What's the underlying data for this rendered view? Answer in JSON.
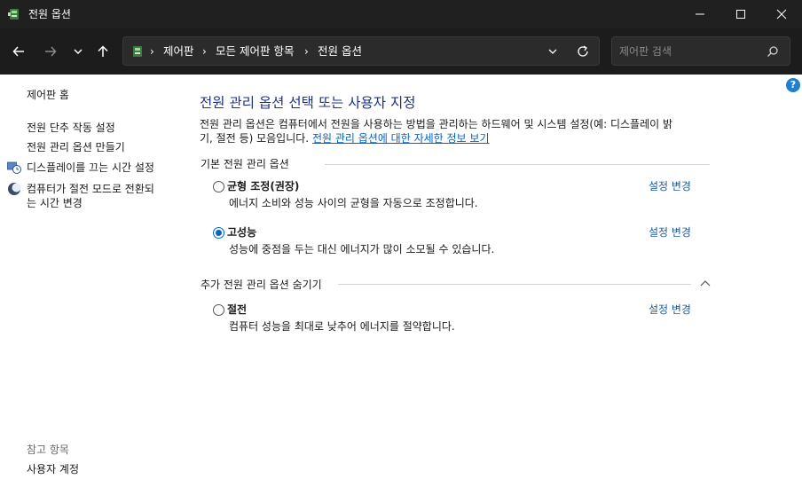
{
  "window": {
    "title": "전원 옵션"
  },
  "address": {
    "crumbs": [
      "제어판",
      "모든 제어판 항목",
      "전원 옵션"
    ],
    "search_placeholder": "제어판 검색"
  },
  "sidebar": {
    "home": "제어판 홈",
    "tasks": [
      "전원 단추 작동 설정",
      "전원 관리 옵션 만들기",
      "디스플레이를 끄는 시간 설정",
      "컴퓨터가 절전 모드로 전환되는 시간 변경"
    ],
    "task_line_wrap": [
      "컴퓨터가 절전 모드로 전환되",
      "는 시간 변경"
    ],
    "see_also_label": "참고 항목",
    "see_also_items": [
      "사용자 계정"
    ]
  },
  "main": {
    "heading": "전원 관리 옵션 선택 또는 사용자 지정",
    "description_line1": "전원 관리 옵션은 컴퓨터에서 전원을 사용하는 방법을 관리하는 하드웨어 및 시스템 설정(예: 디스플레이 밝",
    "description_line2": "기, 절전 등) 모음입니다.",
    "more_info_link": "전원 관리 옵션에 대한 자세한 정보 보기",
    "preferred_section": "기본 전원 관리 옵션",
    "hidden_section": "추가 전원 관리 옵션 숨기기",
    "change_settings": "설정 변경",
    "plans": [
      {
        "name": "균형 조정(권장)",
        "description": "에너지 소비와 성능 사이의 균형을 자동으로 조정합니다.",
        "selected": false
      },
      {
        "name": "고성능",
        "description": "성능에 중점을 두는 대신 에너지가 많이 소모될 수 있습니다.",
        "selected": true
      },
      {
        "name": "절전",
        "description": "컴퓨터 성능을 최대로 낮추어 에너지를 절약합니다.",
        "selected": false
      }
    ]
  },
  "colors": {
    "titlebar": "#202020",
    "heading": "#1e3287",
    "link": "#1e5a9c",
    "accent": "#0067c0"
  },
  "icons": [
    "power-options-icon",
    "minimize-icon",
    "maximize-icon",
    "close-icon",
    "back-arrow-icon",
    "forward-arrow-icon",
    "recent-dropdown-icon",
    "up-arrow-icon",
    "control-panel-icon",
    "chevron-down-icon",
    "refresh-icon",
    "search-icon",
    "help-icon",
    "display-clock-icon",
    "sleep-moon-icon",
    "chevron-up-icon"
  ]
}
